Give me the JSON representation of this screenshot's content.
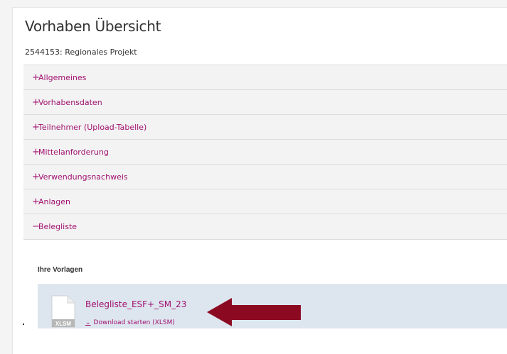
{
  "page": {
    "title": "Vorhaben Übersicht",
    "project": "2544153: Regionales Projekt"
  },
  "accordion": {
    "sections": [
      {
        "sign": "+",
        "label": "Allgemeines"
      },
      {
        "sign": "+",
        "label": "Vorhabensdaten"
      },
      {
        "sign": "+",
        "label": "Teilnehmer (Upload-Tabelle)"
      },
      {
        "sign": "+",
        "label": "Mittelanforderung"
      },
      {
        "sign": "+",
        "label": "Verwendungsnachweis"
      },
      {
        "sign": "+",
        "label": "Anlagen"
      },
      {
        "sign": "−",
        "label": "Belegliste"
      }
    ]
  },
  "belegliste": {
    "templates_heading": "Ihre Vorlagen",
    "template": {
      "file_name": "Belegliste_ESF+_SM_23",
      "file_type_badge": "XLSM",
      "download_label": "Download starten (XLSM)",
      "download_icon": "download-icon"
    }
  },
  "colors": {
    "accent": "#a0106e",
    "arrow": "#8b0a22",
    "accordion_bg": "#f3f3f3",
    "card_bg": "#dde5ef"
  }
}
